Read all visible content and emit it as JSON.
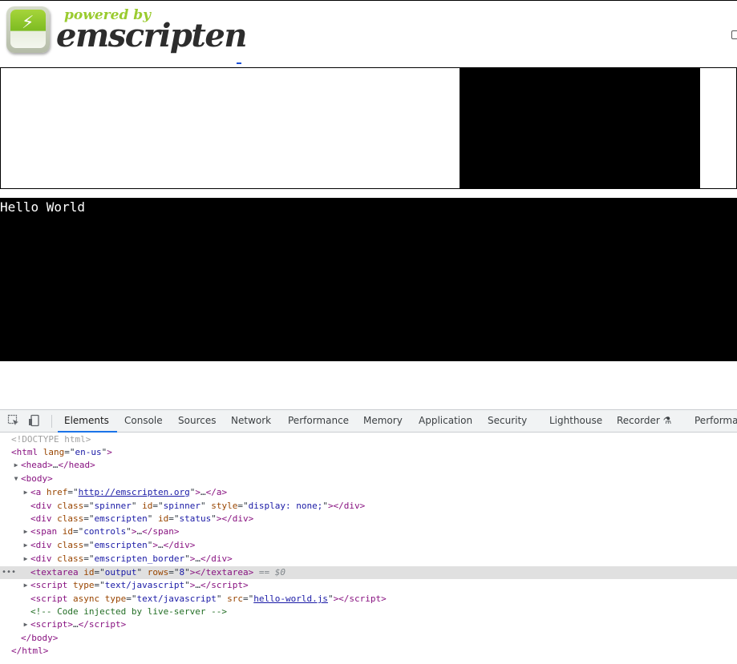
{
  "logo": {
    "powered_by": "powered by",
    "name": "emscripten",
    "href": "http://emscripten.org"
  },
  "output": {
    "text": "Hello World"
  },
  "devtools": {
    "tabs": [
      "Elements",
      "Console",
      "Sources",
      "Network",
      "Performance",
      "Memory",
      "Application",
      "Security",
      "Lighthouse",
      "Recorder ⚗",
      "Performa"
    ],
    "active_tab": "Elements",
    "icons": [
      "inspect-element-icon",
      "device-toolbar-icon"
    ],
    "selected_suffix": "== $0",
    "dom": {
      "doctype": "<!DOCTYPE html>",
      "html_open": {
        "tag": "html",
        "attr": "lang",
        "val": "en-us"
      },
      "head": {
        "tag": "head",
        "ellipsis": "…"
      },
      "body_open": "body",
      "a": {
        "tag": "a",
        "attr": "href",
        "val": "http://emscripten.org",
        "ellipsis": "…"
      },
      "spinner": {
        "tag": "div",
        "a1": "class",
        "v1": "spinner",
        "a2": "id",
        "v2": "spinner",
        "a3": "style",
        "v3": "display: none;"
      },
      "status": {
        "tag": "div",
        "a1": "class",
        "v1": "emscripten",
        "a2": "id",
        "v2": "status"
      },
      "controls": {
        "tag": "span",
        "attr": "id",
        "val": "controls",
        "ellipsis": "…"
      },
      "emscripten": {
        "tag": "div",
        "attr": "class",
        "val": "emscripten",
        "ellipsis": "…"
      },
      "border": {
        "tag": "div",
        "attr": "class",
        "val": "emscripten_border",
        "ellipsis": "…"
      },
      "textarea": {
        "tag": "textarea",
        "a1": "id",
        "v1": "output",
        "a2": "rows",
        "v2": "8"
      },
      "script1": {
        "tag": "script",
        "attr": "type",
        "val": "text/javascript",
        "ellipsis": "…"
      },
      "script2": {
        "tag": "script",
        "a0": "async",
        "a1": "type",
        "v1": "text/javascript",
        "a2": "src",
        "v2": "hello-world.js"
      },
      "comment": "<!-- Code injected by live-server -->",
      "script3": {
        "tag": "script",
        "ellipsis": "…"
      },
      "body_close": "</body>",
      "html_close": "</html>"
    }
  }
}
